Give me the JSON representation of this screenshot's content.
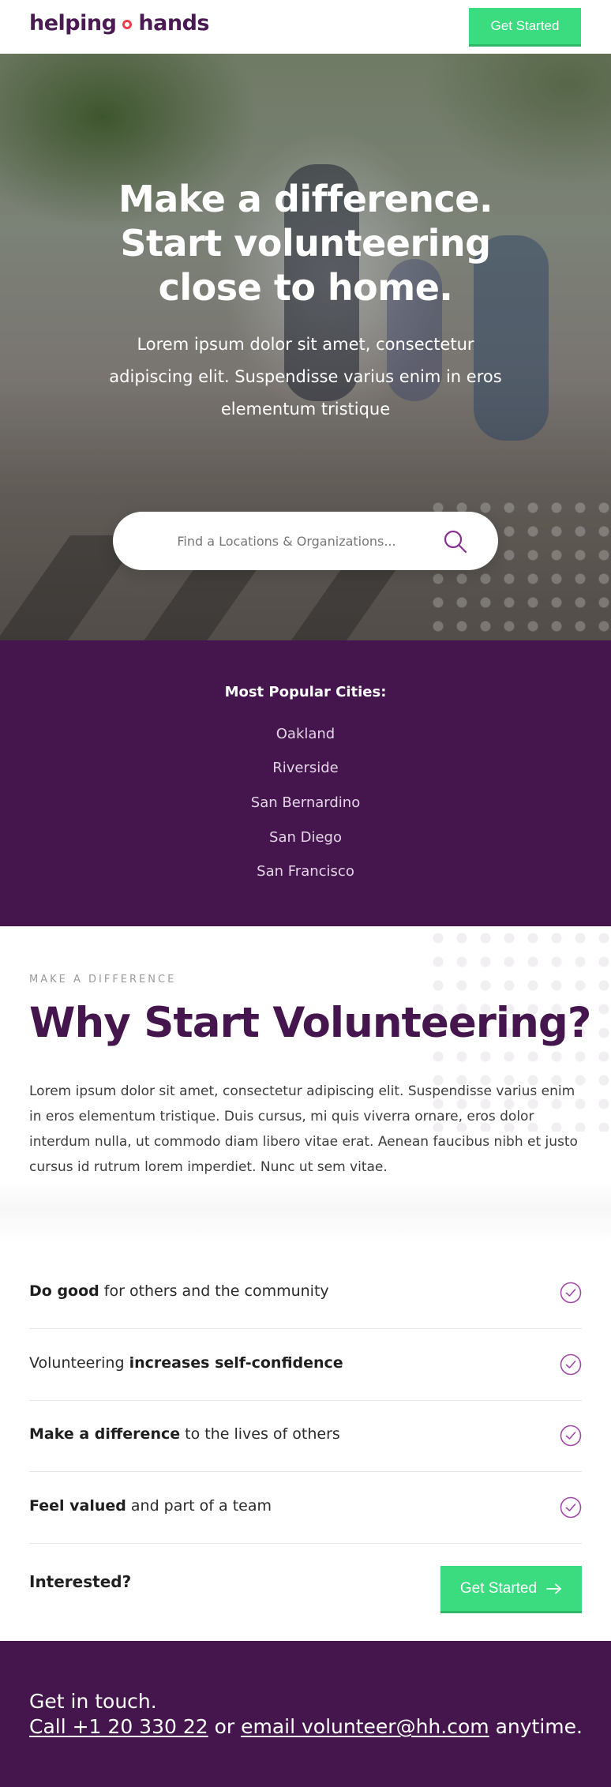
{
  "header": {
    "logo_left": "helping",
    "logo_right": "hands",
    "cta_label": "Get Started"
  },
  "hero": {
    "title_line1": "Make a difference.",
    "title_line2": "Start volunteering",
    "title_line3": "close to home.",
    "subtitle": "Lorem ipsum dolor sit amet, consectetur adipiscing elit. Suspendisse varius enim in eros elementum tristique",
    "search_placeholder": "Find a Locations & Organizations..."
  },
  "cities": {
    "title": "Most Popular Cities:",
    "items": [
      "Oakland",
      "Riverside",
      "San Bernardino",
      "San Diego",
      "San Francisco"
    ]
  },
  "why": {
    "eyebrow": "MAKE A DIFFERENCE",
    "title": "Why Start Volunteering?",
    "body": "Lorem ipsum dolor sit amet, consectetur adipiscing elit. Suspendisse varius enim in eros elementum tristique. Duis cursus, mi quis viverra ornare, eros dolor interdum nulla, ut commodo diam libero vitae erat. Aenean faucibus nibh et justo cursus id rutrum lorem imperdiet. Nunc ut sem vitae.",
    "benefits": [
      {
        "bold": "Do good",
        "rest": " for others and the community",
        "bold_first": true
      },
      {
        "pre": "Volunteering ",
        "bold": "increases self-confidence",
        "bold_first": false
      },
      {
        "bold": "Make a difference",
        "rest": " to the lives of others",
        "bold_first": true
      },
      {
        "bold": "Feel valued",
        "rest": " and part of a team",
        "bold_first": true
      }
    ],
    "interested_label": "Interested?",
    "cta_label": "Get Started"
  },
  "footer": {
    "line1": "Get in touch.",
    "call_link": "Call +1 20 330 22",
    "or_text": " or ",
    "email_link": "email volunteer@hh.com",
    "suffix": " anytime."
  },
  "colors": {
    "brand_purple": "#45164d",
    "accent_green": "#3bdc80",
    "logo_dot_red": "#ef3d4f",
    "check_purple": "#a04aa8"
  }
}
